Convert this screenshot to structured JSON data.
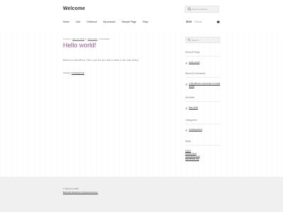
{
  "site": {
    "title": "Welcome"
  },
  "header_search": {
    "placeholder": "Search products…"
  },
  "nav": [
    {
      "label": "Home"
    },
    {
      "label": "Cart"
    },
    {
      "label": "Checkout"
    },
    {
      "label": "My account"
    },
    {
      "label": "Sample Page"
    },
    {
      "label": "Shop"
    }
  ],
  "cart": {
    "amount": "$0.00",
    "items": "0 items"
  },
  "post": {
    "meta_posted": "Posted on",
    "date": "May 14, 2015",
    "by": "by",
    "author": "ttdemo4wp",
    "comment": "1 Comment",
    "title": "Hello world!",
    "body": "Welcome to WordPress. This is your first post. Edit or delete it, then start writing!",
    "category_label": "Category",
    "category": "Uncategorized"
  },
  "sidebar": {
    "search_placeholder": "Search…",
    "recent_posts_title": "Recent Posts",
    "recent_posts": [
      "Hello world!"
    ],
    "recent_comments_title": "Recent Comments",
    "recent_comment": "A WordPress Commenter on Hello world!",
    "archives_title": "Archives",
    "archives": [
      "May 2015"
    ],
    "categories_title": "Categories",
    "categories": [
      "Uncategorized"
    ],
    "meta_title": "Meta",
    "meta_links": [
      "Log in",
      "Entries feed",
      "Comments feed",
      "WordPress.org"
    ]
  },
  "footer": {
    "copyright": "© Welcome 2015",
    "built_with": "Built with Storefront & WooCommerce."
  },
  "colors": {
    "accent": "#96588a",
    "footer_bg": "#f0f0f0"
  }
}
